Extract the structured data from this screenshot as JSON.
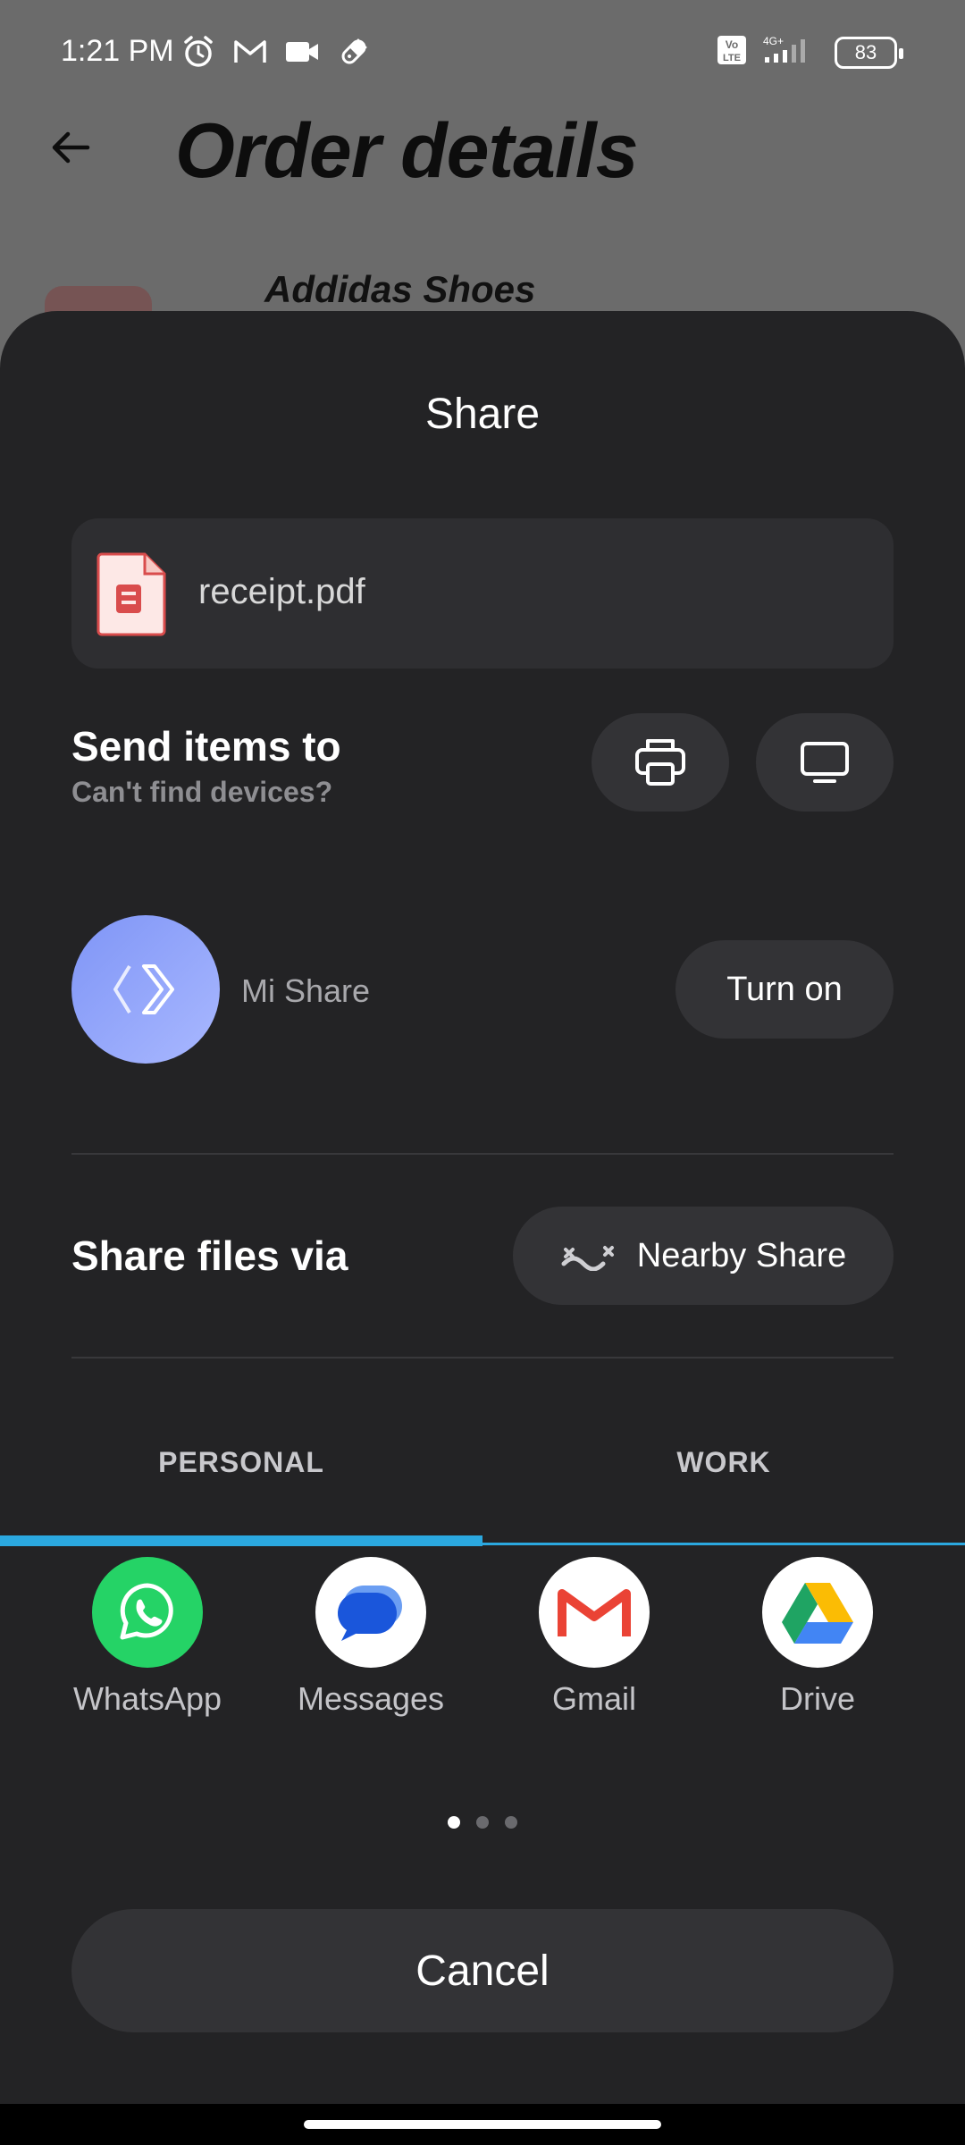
{
  "status_bar": {
    "time": "1:21 PM",
    "left_icons": [
      "alarm-icon",
      "gmail-icon",
      "video-icon",
      "pill-icon"
    ],
    "network": "4G+",
    "volte": "Vo LTE",
    "battery": "83"
  },
  "background_page": {
    "title": "Order details",
    "product_name": "Addidas Shoes"
  },
  "share_sheet": {
    "title": "Share",
    "file": {
      "name": "receipt.pdf",
      "icon": "pdf-file-icon"
    },
    "send_items": {
      "title": "Send items to",
      "subtitle": "Can't find devices?",
      "buttons": [
        "printer-icon",
        "monitor-icon"
      ]
    },
    "mi_share": {
      "label": "Mi Share",
      "button": "Turn on"
    },
    "share_via": {
      "title": "Share files via",
      "button": "Nearby Share"
    },
    "tabs": [
      {
        "label": "PERSONAL",
        "selected": true
      },
      {
        "label": "WORK",
        "selected": false
      }
    ],
    "apps": [
      {
        "label": "WhatsApp",
        "icon": "whatsapp-icon",
        "color": "#25D366"
      },
      {
        "label": "Messages",
        "icon": "messages-icon",
        "color": "#1A73E8"
      },
      {
        "label": "Gmail",
        "icon": "gmail-icon",
        "color": "#EA4335"
      },
      {
        "label": "Drive",
        "icon": "drive-icon",
        "color": "#1FA463"
      }
    ],
    "page_indicator": {
      "pages": 3,
      "current": 1
    },
    "cancel": "Cancel"
  },
  "colors": {
    "sheet_bg": "#232325",
    "accent": "#2BA8E0",
    "button_bg": "#333336",
    "scrim": "#6B6B6B"
  }
}
